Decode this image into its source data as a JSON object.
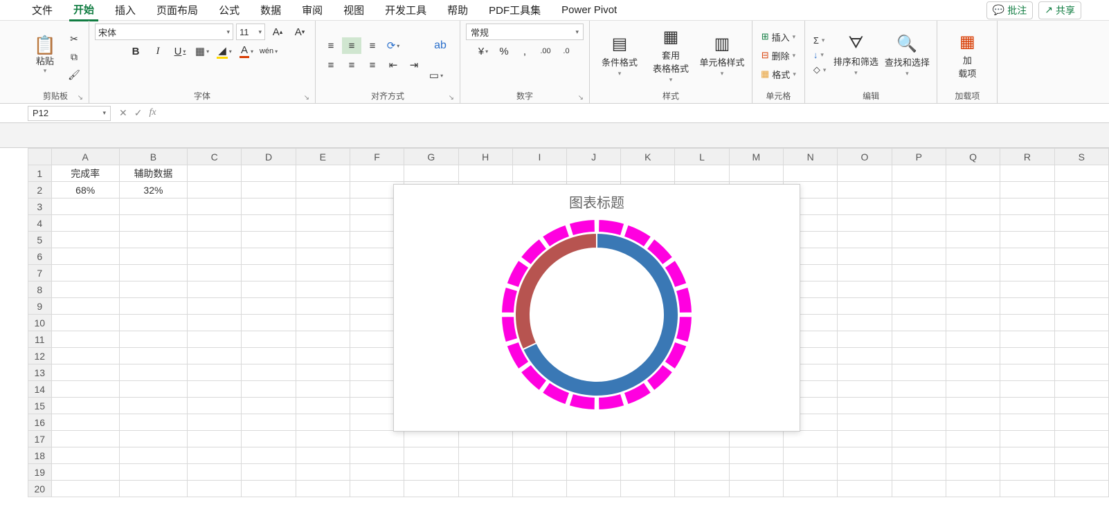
{
  "menu": {
    "items": [
      "文件",
      "开始",
      "插入",
      "页面布局",
      "公式",
      "数据",
      "审阅",
      "视图",
      "开发工具",
      "帮助",
      "PDF工具集",
      "Power Pivot"
    ],
    "active_index": 1,
    "comment": "批注",
    "share": "共享"
  },
  "ribbon": {
    "clipboard": {
      "paste": "粘贴",
      "label": "剪贴板"
    },
    "font": {
      "name": "宋体",
      "size": "11",
      "label": "字体",
      "bold": "B",
      "italic": "I",
      "underline": "U",
      "phonetic": "wén"
    },
    "align": {
      "label": "对齐方式",
      "wrap": "ab"
    },
    "number": {
      "format": "常规",
      "label": "数字"
    },
    "styles": {
      "cond": "条件格式",
      "table": "套用\n表格格式",
      "cell": "单元格样式",
      "label": "样式"
    },
    "cells": {
      "insert": "插入",
      "delete": "删除",
      "format": "格式",
      "label": "单元格"
    },
    "editing": {
      "sort": "排序和筛选",
      "find": "查找和选择",
      "label": "编辑"
    },
    "addins": {
      "btn": "加\n载项",
      "label": "加载项"
    }
  },
  "fx": {
    "cell_ref": "P12"
  },
  "sheet": {
    "columns": [
      "A",
      "B",
      "C",
      "D",
      "E",
      "F",
      "G",
      "H",
      "I",
      "J",
      "K",
      "L",
      "M",
      "N",
      "O",
      "P",
      "Q",
      "R",
      "S"
    ],
    "rows": 20,
    "data": {
      "A1": "完成率",
      "B1": "辅助数据",
      "A2": "68%",
      "B2": "32%"
    }
  },
  "chart_data": {
    "type": "doughnut",
    "title": "图表标题",
    "inner_ring": {
      "series": [
        {
          "name": "完成率",
          "value": 68,
          "color": "#3a78b5"
        },
        {
          "name": "辅助数据",
          "value": 32,
          "color": "#b75450"
        }
      ]
    },
    "outer_ring": {
      "segments": 20,
      "color": "#ff00e0",
      "gap_color": "#ffffff"
    }
  }
}
